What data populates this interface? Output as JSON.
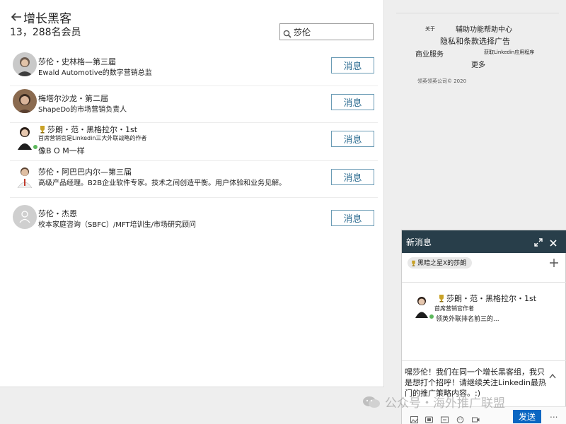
{
  "header": {
    "title": "增长黑客",
    "member_count": "13，288名会员",
    "search_value": "莎伦"
  },
  "members": [
    {
      "name": "莎伦・史林格—第三届",
      "headline": "Ewald Automotive的数字营销总监",
      "extra": "",
      "button": "消息"
    },
    {
      "name": "梅塔尔沙龙・第二届",
      "headline": "ShapeDo的市场营销负责人",
      "extra": "",
      "button": "消息"
    },
    {
      "name": "莎朗・范・黑格拉尔・1st",
      "headline": "首席营销官是Linkedin三大外联战略的作者",
      "extra": "像B O M一样",
      "button": "消息"
    },
    {
      "name": "莎伦・阿巴巴内尔—第三届",
      "headline": "高级产品经理。B2B企业软件专家。技术之间创造平衡。用户体验和业务见解。",
      "extra": "",
      "button": "消息"
    },
    {
      "name": "莎伦・杰恩",
      "headline": "校本家庭咨询（SBFC）/MFT培训生/市场研究顾问",
      "extra": "",
      "button": "消息"
    }
  ],
  "footer": {
    "about": "关于",
    "accessibility": "辅助功能帮助中心",
    "privacy": "隐私和条款选择广告",
    "business": "商业服务",
    "get_app": "获取Linkedin应用程序",
    "more": "更多",
    "copyright": "领英领英公司© 2020"
  },
  "chat": {
    "title": "新消息",
    "recipient": "黑暗之星X的莎朗",
    "card_name": "莎朗・范・黑格拉尔・1st",
    "card_title": "首席营销官作者",
    "card_detail": "领英外联排名前三的...",
    "message": "嘿莎伦！我们在同一个增长黑客组，我只是想打个招呼！请继续关注Linkedin最热门的推广策略内容。:)",
    "send": "发送",
    "more": "..."
  },
  "watermark": {
    "text": "公众号・海外推广联盟"
  },
  "colors": {
    "button_border": "#6a9bb5",
    "chat_header": "#283e4a",
    "send_button": "#0a66c2",
    "online": "#5cb85c"
  }
}
